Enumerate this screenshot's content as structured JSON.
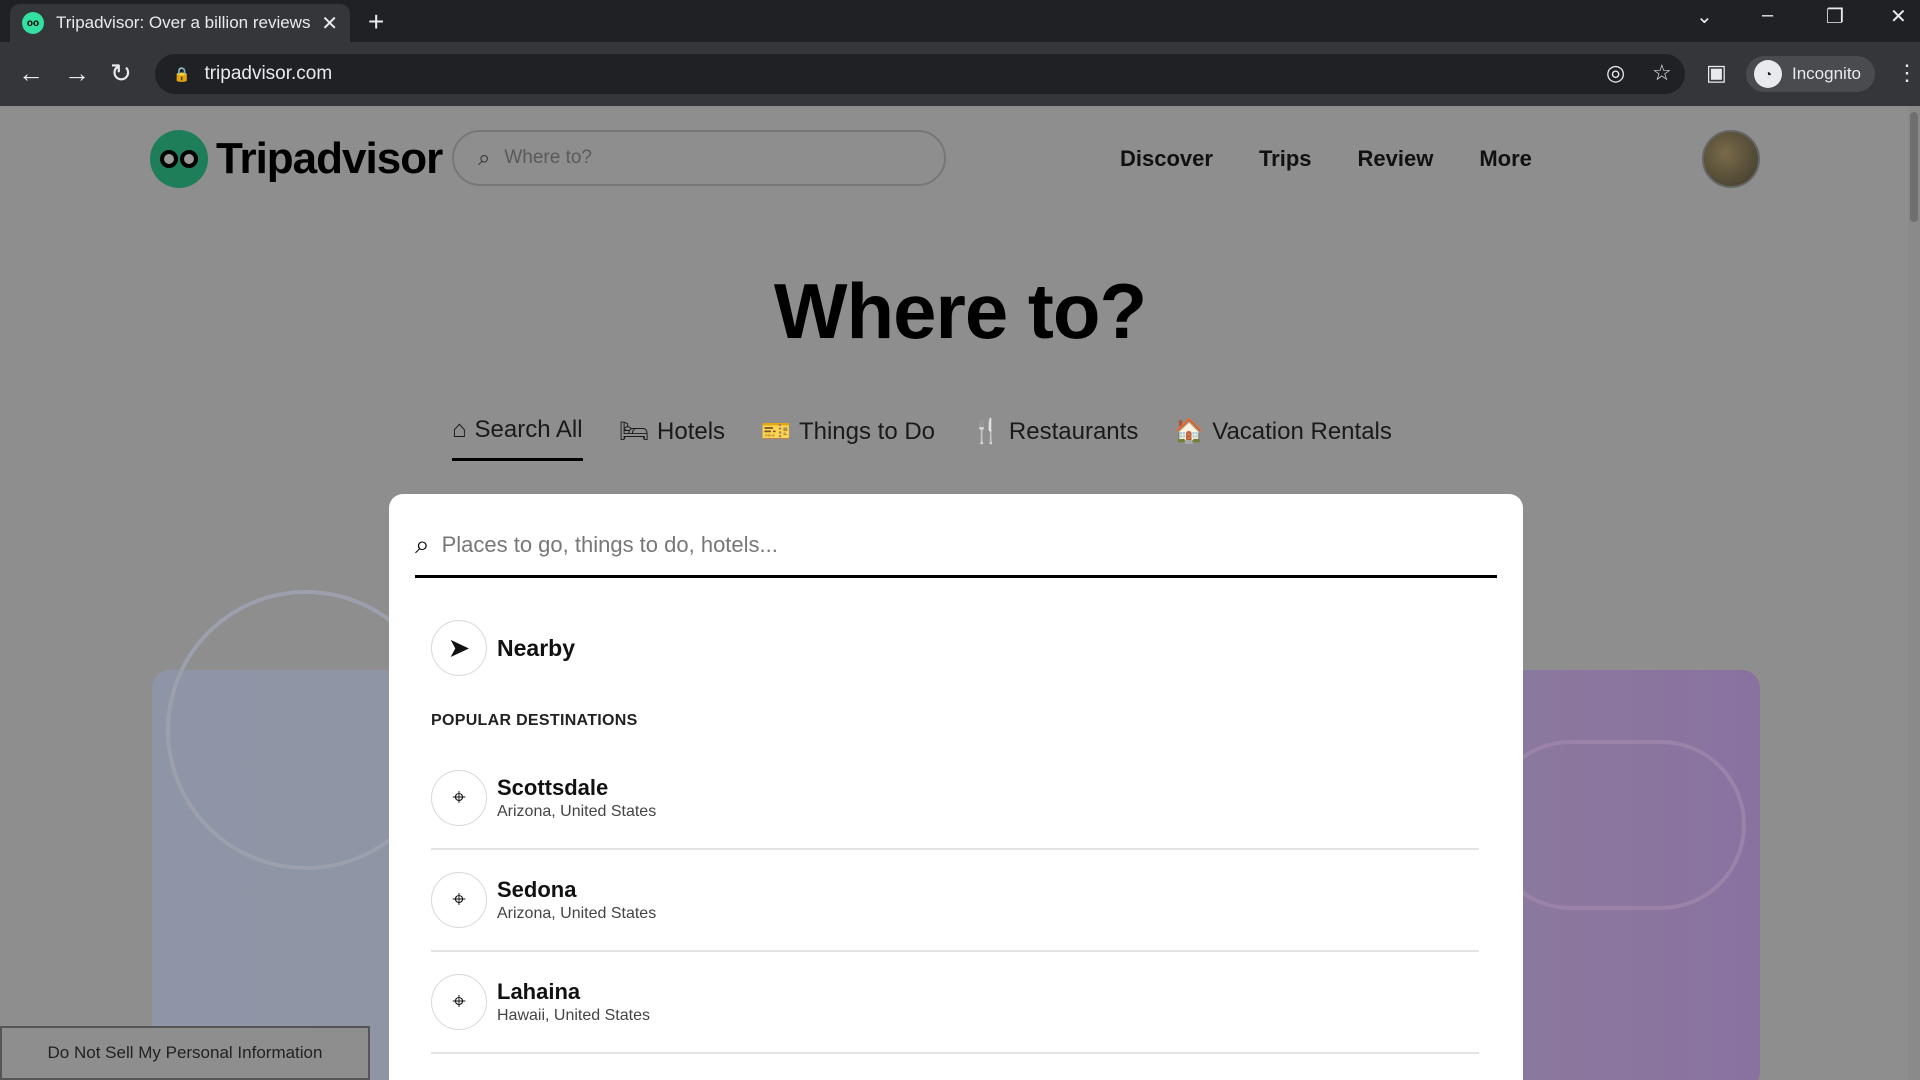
{
  "browser": {
    "tab_title": "Tripadvisor: Over a billion reviews & contributions for Hotels, Attractions, Restaurants, and more",
    "tab_close": "✕",
    "new_tab": "+",
    "url": "tripadvisor.com",
    "incognito_label": "Incognito"
  },
  "header": {
    "logo_text": "Tripadvisor",
    "search_placeholder": "Where to?",
    "nav": [
      "Discover",
      "Trips",
      "Review",
      "More"
    ]
  },
  "hero": {
    "title": "Where to?"
  },
  "search_tabs": [
    {
      "label": "Search All",
      "icon": "home-icon",
      "active": true
    },
    {
      "label": "Hotels",
      "icon": "bed-icon",
      "active": false
    },
    {
      "label": "Things to Do",
      "icon": "ticket-icon",
      "active": false
    },
    {
      "label": "Restaurants",
      "icon": "utensils-icon",
      "active": false
    },
    {
      "label": "Vacation Rentals",
      "icon": "house-key-icon",
      "active": false
    }
  ],
  "dropdown": {
    "placeholder": "Places to go, things to do, hotels...",
    "nearby_label": "Nearby",
    "section_title": "POPULAR DESTINATIONS",
    "destinations": [
      {
        "name": "Scottsdale",
        "region": "Arizona, United States"
      },
      {
        "name": "Sedona",
        "region": "Arizona, United States"
      },
      {
        "name": "Lahaina",
        "region": "Hawaii, United States"
      }
    ]
  },
  "footer": {
    "do_not_sell": "Do Not Sell My Personal Information"
  },
  "colors": {
    "brand_green": "#34e0a1",
    "overlay_gray": "#8e8e8e"
  }
}
